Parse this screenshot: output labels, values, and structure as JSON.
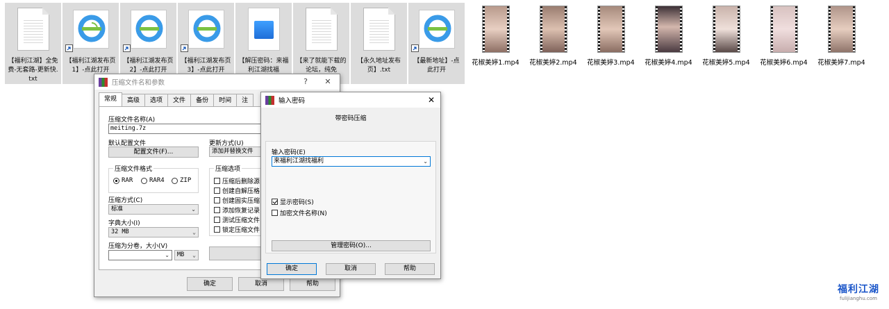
{
  "files": [
    {
      "name": "【福利江湖】全免费-无套路-更新快.txt",
      "icon": "text-document-icon"
    },
    {
      "name": "【福利江湖发布页1】-点此打开",
      "icon": "internet-shortcut-icon"
    },
    {
      "name": "【福利江湖发布页2】-点此打开",
      "icon": "internet-shortcut-icon"
    },
    {
      "name": "【福利江湖发布页3】-点此打开",
      "icon": "internet-shortcut-icon"
    },
    {
      "name": "【解压密码：来福利江湖找福",
      "icon": "image-file-icon"
    },
    {
      "name": "【来了就能下载的论坛，纯免",
      "icon": "text-document-icon"
    },
    {
      "name": "【永久地址发布页】.txt",
      "icon": "text-document-icon"
    },
    {
      "name": "【最新地址】-点此打开",
      "icon": "internet-shortcut-icon"
    },
    {
      "name": "花椒美婷1.mp4",
      "icon": "video-thumbnail"
    },
    {
      "name": "花椒美婷2.mp4",
      "icon": "video-thumbnail"
    },
    {
      "name": "花椒美婷3.mp4",
      "icon": "video-thumbnail"
    },
    {
      "name": "花椒美婷4.mp4",
      "icon": "video-thumbnail"
    },
    {
      "name": "花椒美婷5.mp4",
      "icon": "video-thumbnail"
    },
    {
      "name": "花椒美婷6.mp4",
      "icon": "video-thumbnail"
    },
    {
      "name": "花椒美婷7.mp4",
      "icon": "video-thumbnail"
    }
  ],
  "archive_dialog": {
    "title": "压缩文件名和参数",
    "help_glyph": "?",
    "close_glyph": "✕",
    "tabs": [
      "常规",
      "高级",
      "选项",
      "文件",
      "备份",
      "时间",
      "注"
    ],
    "archive_name_label": "压缩文件名称(A)",
    "archive_name_value": "meiting.7z",
    "default_profile_label": "默认配置文件",
    "profiles_button": "配置文件(F)...",
    "update_mode_label": "更新方式(U)",
    "update_mode_value": "添加并替换文件",
    "format_group_label": "压缩文件格式",
    "formats": [
      {
        "label": "RAR",
        "selected": true
      },
      {
        "label": "RAR4",
        "selected": false
      },
      {
        "label": "ZIP",
        "selected": false
      }
    ],
    "options_group_label": "压缩选项",
    "options": [
      {
        "label": "压缩后删除源",
        "checked": false
      },
      {
        "label": "创建自解压格",
        "checked": false
      },
      {
        "label": "创建固实压缩",
        "checked": false
      },
      {
        "label": "添加恢复记录",
        "checked": false
      },
      {
        "label": "测试压缩文件",
        "checked": false
      },
      {
        "label": "锁定压缩文件",
        "checked": false
      }
    ],
    "method_label": "压缩方式(C)",
    "method_value": "标准",
    "dict_label": "字典大小(I)",
    "dict_value": "32 MB",
    "split_label": "压缩为分卷，大小(V)",
    "split_value": "",
    "split_unit": "MB",
    "set_password_button": "设置密",
    "ok_button": "确定",
    "cancel_button": "取消",
    "help_button": "帮助"
  },
  "password_dialog": {
    "title": "输入密码",
    "close_glyph": "✕",
    "heading": "带密码压缩",
    "password_label": "输入密码(E)",
    "password_value": "来福利江湖找福利",
    "show_password_label": "显示密码(S)",
    "show_password_checked": true,
    "encrypt_names_label": "加密文件名称(N)",
    "encrypt_names_checked": false,
    "manage_button": "管理密码(O)...",
    "ok_button": "确定",
    "cancel_button": "取消",
    "help_button": "帮助"
  },
  "watermark": {
    "logo_text": "福利江湖",
    "url": "fulijianghu.com"
  },
  "colors": {
    "tile_background": "#dcdcdc",
    "dialog_background": "#f0f0f0",
    "default_button_border": "#0078d7",
    "ie_blue": "#3a9be8",
    "ie_green": "#7cc242"
  }
}
